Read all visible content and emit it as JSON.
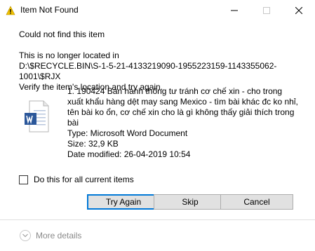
{
  "window": {
    "title": "Item Not Found",
    "controls": {
      "minimize": "—",
      "maximize": "☐",
      "close": "✕"
    }
  },
  "dialog": {
    "heading": "Could not find this item",
    "location_line1": "This is no longer located in",
    "location_path": "D:\\$RECYCLE.BIN\\S-1-5-21-4133219090-1955223159-1143355062-1001\\$RJX",
    "verify_text": "Verify the item's location and try again."
  },
  "file": {
    "icon": "word-document-icon",
    "name": "1. 190424 Ban hành thông tư tránh cơ chế xin - cho trong xuất khẩu hàng dệt may sang Mexico - tìm bài khác đc ko nhỉ, tên bài ko ổn, cơ chế xin cho là gì không thấy giải thích trong bài",
    "type": "Type: Microsoft Word Document",
    "size": "Size: 32,9 KB",
    "date": "Date modified: 26-04-2019 10:54"
  },
  "checkbox": {
    "label": "Do this for all current items",
    "checked": false
  },
  "buttons": {
    "try_again": "Try Again",
    "skip": "Skip",
    "cancel": "Cancel"
  },
  "footer": {
    "more_details": "More details",
    "icon": "chevron-down-icon"
  },
  "colors": {
    "accent": "#0078d7",
    "word_blue": "#2b579a"
  }
}
